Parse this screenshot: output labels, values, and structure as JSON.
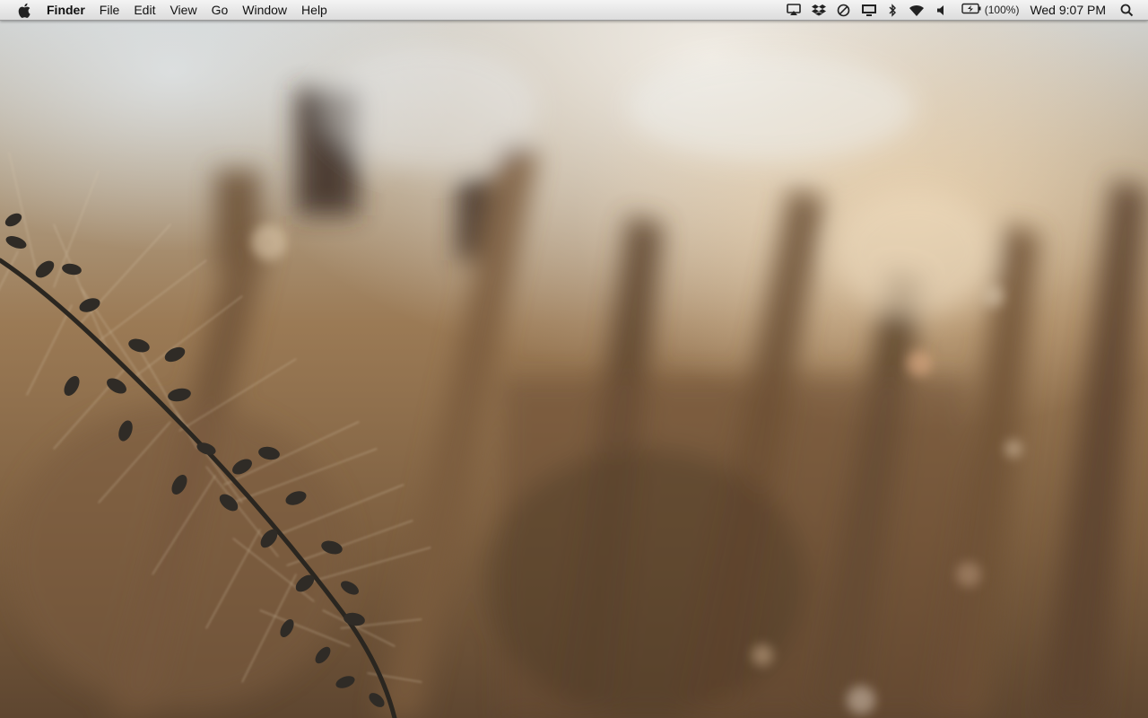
{
  "menubar": {
    "apple_icon": "apple-icon",
    "app_name": "Finder",
    "menus": [
      "File",
      "Edit",
      "View",
      "Go",
      "Window",
      "Help"
    ],
    "status": {
      "icons": [
        "airplay-icon",
        "dropbox-icon",
        "do-not-disturb-icon",
        "display-mirroring-icon",
        "bluetooth-icon",
        "wifi-icon",
        "volume-icon",
        "battery-icon",
        "spotlight-search-icon"
      ],
      "battery_percent": "(100%)",
      "clock": "Wed 9:07 PM"
    }
  },
  "wallpaper": {
    "description_colors": {
      "sky": "#dfe3e6",
      "warm_light": "#e8cfa8",
      "dried_grass": "#9b7a55",
      "shadow": "#4a3624",
      "plant_dark": "#2d2a24"
    }
  }
}
